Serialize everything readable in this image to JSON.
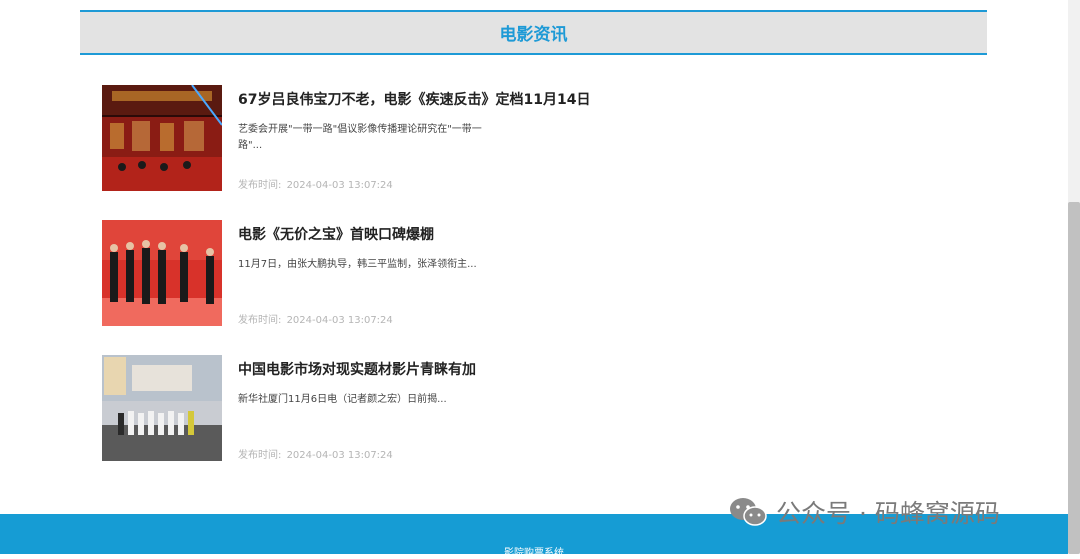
{
  "section": {
    "title": "电影资讯"
  },
  "news": [
    {
      "title": "67岁吕良伟宝刀不老，电影《疾速反击》定档11月14日",
      "summary": "艺委会开展\"一带一路\"倡议影像传播理论研究在\"一带一路\"...",
      "date_label": "发布时间:",
      "date_value": "2024-04-03 13:07:24"
    },
    {
      "title": "电影《无价之宝》首映口碑爆棚",
      "summary": "11月7日，由张大鹏执导，韩三平监制，张泽领衔主...",
      "date_label": "发布时间:",
      "date_value": "2024-04-03 13:07:24"
    },
    {
      "title": "中国电影市场对现实题材影片青睐有加",
      "summary": "新华社厦门11月6日电（记者颜之宏）日前揭...",
      "date_label": "发布时间:",
      "date_value": "2024-04-03 13:07:24"
    }
  ],
  "footer": {
    "text": "影院购票系统"
  },
  "watermark": {
    "text": "公众号 · 码蜂窝源码",
    "icon": "wechat-icon"
  },
  "colors": {
    "accent": "#1e9ad6",
    "footer_bg": "#169cd4",
    "header_bg": "#e3e3e3"
  }
}
